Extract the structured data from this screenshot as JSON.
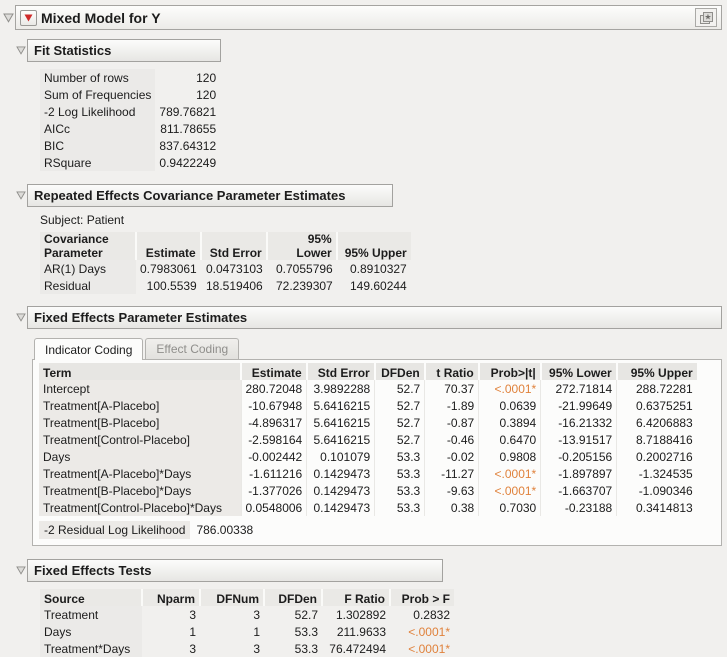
{
  "report": {
    "title": "Mixed Model for Y"
  },
  "fit_statistics": {
    "title": "Fit Statistics",
    "rows": [
      [
        "Number of rows",
        "120"
      ],
      [
        "Sum of Frequencies",
        "120"
      ],
      [
        "-2 Log Likelihood",
        "789.76821"
      ],
      [
        "AICc",
        "811.78655"
      ],
      [
        "BIC",
        "837.64312"
      ],
      [
        "RSquare",
        "0.9422249"
      ]
    ]
  },
  "repeated_effects": {
    "title": "Repeated Effects Covariance Parameter Estimates",
    "subject": "Subject: Patient",
    "columns": [
      "Covariance\nParameter",
      "Estimate",
      "Std Error",
      "95% Lower",
      "95% Upper"
    ],
    "rows": [
      [
        "AR(1) Days",
        "0.7983061",
        "0.0473103",
        "0.7055796",
        "0.8910327"
      ],
      [
        "Residual",
        "100.5539",
        "18.519406",
        "72.239307",
        "149.60244"
      ]
    ]
  },
  "fixed_effects": {
    "title": "Fixed Effects Parameter Estimates",
    "tabs": [
      "Indicator Coding",
      "Effect Coding"
    ],
    "active_tab": "Indicator Coding",
    "columns": [
      "Term",
      "Estimate",
      "Std Error",
      "DFDen",
      "t Ratio",
      "Prob>|t|",
      "95% Lower",
      "95% Upper"
    ],
    "rows": [
      [
        "Intercept",
        "280.72048",
        "3.9892288",
        "52.7",
        "70.37",
        "<.0001*",
        "272.71814",
        "288.72281"
      ],
      [
        "Treatment[A-Placebo]",
        "-10.67948",
        "5.6416215",
        "52.7",
        "-1.89",
        "0.0639",
        "-21.99649",
        "0.6375251"
      ],
      [
        "Treatment[B-Placebo]",
        "-4.896317",
        "5.6416215",
        "52.7",
        "-0.87",
        "0.3894",
        "-16.21332",
        "6.4206883"
      ],
      [
        "Treatment[Control-Placebo]",
        "-2.598164",
        "5.6416215",
        "52.7",
        "-0.46",
        "0.6470",
        "-13.91517",
        "8.7188416"
      ],
      [
        "Days",
        "-0.002442",
        "0.101079",
        "53.3",
        "-0.02",
        "0.9808",
        "-0.205156",
        "0.2002716"
      ],
      [
        "Treatment[A-Placebo]*Days",
        "-1.611216",
        "0.1429473",
        "53.3",
        "-11.27",
        "<.0001*",
        "-1.897897",
        "-1.324535"
      ],
      [
        "Treatment[B-Placebo]*Days",
        "-1.377026",
        "0.1429473",
        "53.3",
        "-9.63",
        "<.0001*",
        "-1.663707",
        "-1.090346"
      ],
      [
        "Treatment[Control-Placebo]*Days",
        "0.0548006",
        "0.1429473",
        "53.3",
        "0.38",
        "0.7030",
        "-0.23188",
        "0.3414813"
      ]
    ],
    "residual_label": "-2 Residual Log Likelihood",
    "residual_value": "786.00338"
  },
  "fixed_effects_tests": {
    "title": "Fixed Effects Tests",
    "columns": [
      "Source",
      "Nparm",
      "DFNum",
      "DFDen",
      "F Ratio",
      "Prob > F"
    ],
    "rows": [
      [
        "Treatment",
        "3",
        "3",
        "52.7",
        "1.302892",
        "0.2832"
      ],
      [
        "Days",
        "1",
        "1",
        "53.3",
        "211.9633",
        "<.0001*"
      ],
      [
        "Treatment*Days",
        "3",
        "3",
        "53.3",
        "76.472494",
        "<.0001*"
      ]
    ]
  },
  "colors": {
    "significant": "#e0823c",
    "red_triangle": "#cf2b2b"
  }
}
